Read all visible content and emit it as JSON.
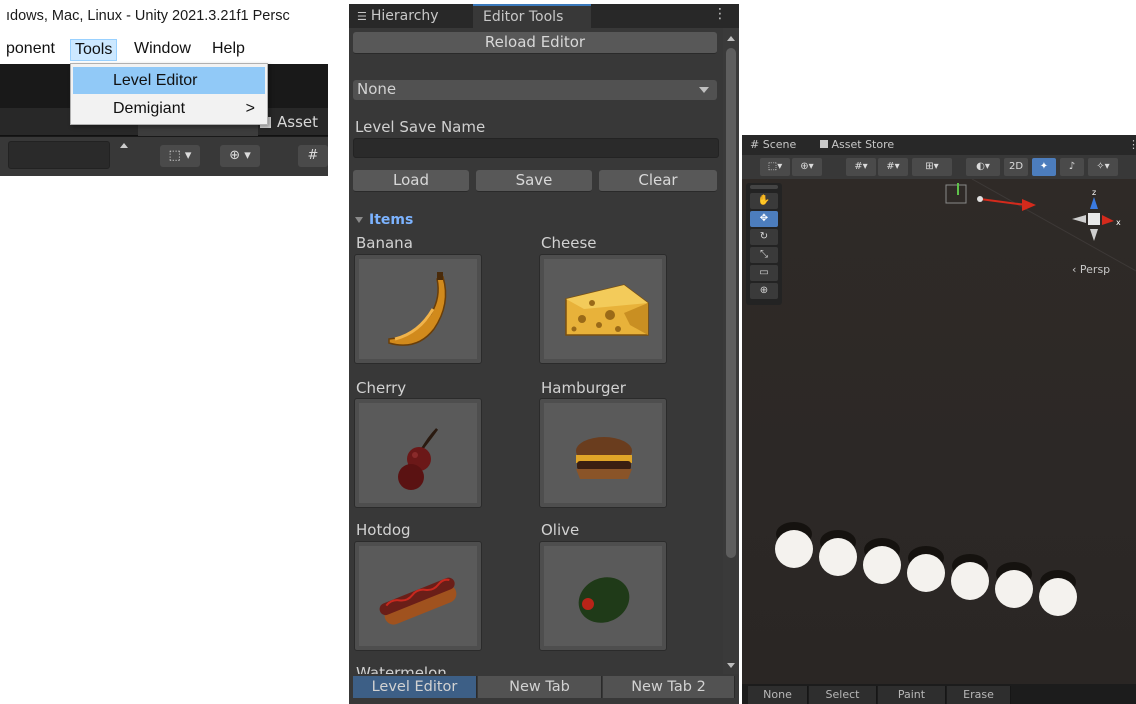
{
  "title_bar": {
    "text": "ıdows, Mac, Linux - Unity 2021.3.21f1 Persc"
  },
  "menubar": {
    "component": "ponent",
    "tools": "Tools",
    "window": "Window",
    "help": "Help"
  },
  "tools_menu": {
    "items": [
      {
        "label": "Level Editor"
      },
      {
        "label": "Demigiant",
        "arrow": ">"
      }
    ]
  },
  "bg_unity": {
    "scene_tab": "# Scene",
    "asset_tab": "Asset"
  },
  "editor_window": {
    "tabs": {
      "hierarchy": "Hierarchy",
      "editor_tools": "Editor Tools"
    },
    "reload_button": "Reload Editor",
    "level_dropdown_value": "None",
    "save_name_label": "Level Save Name",
    "save_name_value": "",
    "load_button": "Load",
    "save_button": "Save",
    "clear_button": "Clear",
    "items_foldout": "Items",
    "items": [
      {
        "name": "Banana",
        "icon": "banana-icon"
      },
      {
        "name": "Cheese",
        "icon": "cheese-icon"
      },
      {
        "name": "Cherry",
        "icon": "cherry-icon"
      },
      {
        "name": "Hamburger",
        "icon": "hamburger-icon"
      },
      {
        "name": "Hotdog",
        "icon": "hotdog-icon"
      },
      {
        "name": "Olive",
        "icon": "olive-icon"
      },
      {
        "name": "Watermelon",
        "icon": "watermelon-icon"
      }
    ],
    "bottom_tabs": [
      "Level Editor",
      "New Tab",
      "New Tab 2"
    ]
  },
  "scene_window": {
    "tabs": {
      "scene": "Scene",
      "asset_store": "Asset Store"
    },
    "toolbar": {
      "btn_2d": "2D"
    },
    "persp_label": "Persp",
    "gizmo_axes": {
      "z": "z",
      "x": "x"
    },
    "bottom_buttons": [
      "None",
      "Select",
      "Paint",
      "Erase"
    ]
  },
  "colors": {
    "accent_blue": "#3a79bb",
    "selected_tab": "#3d5f86",
    "menu_highlight": "#91c9f7"
  }
}
